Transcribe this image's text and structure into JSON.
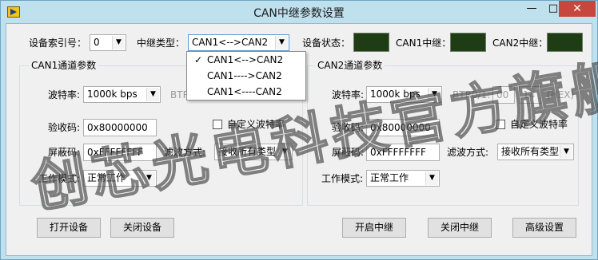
{
  "window": {
    "title": "CAN中继参数设置",
    "min_label": "—",
    "max_label": "□",
    "close_label": "✕"
  },
  "top": {
    "device_index_label": "设备索引号：",
    "device_index_value": "0",
    "relay_type_label": "中继类型：",
    "relay_type_value": "CAN1<-->CAN2",
    "device_status_label": "设备状态：",
    "can1_relay_label": "CAN1中继：",
    "can2_relay_label": "CAN2中继：",
    "led_color": "#1f3d14"
  },
  "relay_type_dropdown": {
    "options": [
      "CAN1<-->CAN2",
      "CAN1---->CAN2",
      "CAN1<----CAN2"
    ],
    "selected_index": 0,
    "check_mark": "✓"
  },
  "can1": {
    "group_title": "CAN1通道参数",
    "baud_label": "波特率:",
    "baud_value": "1000k bps",
    "btr_label": "BTR0/1:",
    "accept_code_label": "验收码:",
    "accept_code_value": "0x80000000",
    "custom_baud_label": "自定义波特率",
    "mask_label": "屏蔽码:",
    "mask_value": "0xFFFFFFFF",
    "filter_label": "滤波方式:",
    "filter_value": "接收所有类型",
    "mode_label": "工作模式:",
    "mode_value": "正常工作"
  },
  "can2": {
    "group_title": "CAN2通道参数",
    "baud_label": "波特率:",
    "baud_value": "1000k bps",
    "btr_label": "BTR0/1:",
    "btr0_value": "00",
    "btr1_value": "14",
    "hex_label": "(HEX)",
    "accept_code_label": "验收码:",
    "accept_code_value": "0x80000000",
    "custom_baud_label": "自定义波特率",
    "mask_label": "屏蔽码:",
    "mask_value": "0xFFFFFFFF",
    "filter_label": "滤波方式:",
    "filter_value": "接收所有类型",
    "mode_label": "工作模式:",
    "mode_value": "正常工作"
  },
  "buttons": {
    "open_device": "打开设备",
    "close_device": "关闭设备",
    "start_relay": "开启中继",
    "stop_relay": "关闭中继",
    "advanced": "高级设置"
  },
  "watermark": "创芯光电科技官方旗舰店"
}
